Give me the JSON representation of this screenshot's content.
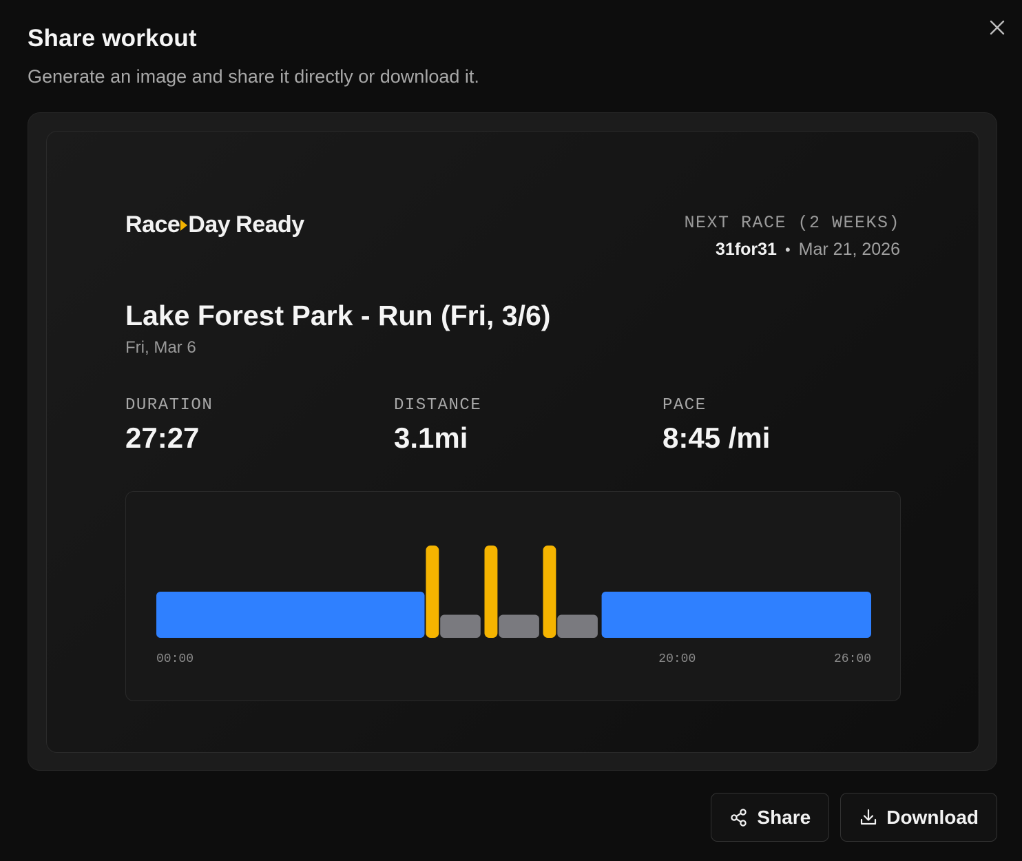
{
  "dialog": {
    "title": "Share workout",
    "subtitle": "Generate an image and share it directly or download it.",
    "close_icon": "close-icon"
  },
  "card": {
    "brand": {
      "part1": "Race",
      "part2": "Day",
      "part3": "Ready",
      "accent_color": "#f5b400"
    },
    "next_race": {
      "label": "NEXT RACE (2 WEEKS)",
      "name": "31for31",
      "separator": "•",
      "date": "Mar 21, 2026"
    },
    "workout": {
      "title": "Lake Forest Park - Run (Fri, 3/6)",
      "date": "Fri, Mar 6"
    },
    "stats": [
      {
        "label": "DURATION",
        "value": "27:27"
      },
      {
        "label": "DISTANCE",
        "value": "3.1mi"
      },
      {
        "label": "PACE",
        "value": "8:45 /mi"
      }
    ]
  },
  "chart_data": {
    "type": "bar",
    "x_unit": "minutes",
    "xlim": [
      0,
      27.45
    ],
    "tick_labels": [
      {
        "label": "00:00",
        "minute": 0
      },
      {
        "label": "20:00",
        "minute": 20
      },
      {
        "label": "26:00",
        "minute": 26
      }
    ],
    "segments": [
      {
        "start": 0.0,
        "end": 10.3,
        "intensity": 2,
        "kind": "easy"
      },
      {
        "start": 10.35,
        "end": 10.85,
        "intensity": 4,
        "kind": "interval"
      },
      {
        "start": 10.9,
        "end": 12.45,
        "intensity": 1,
        "kind": "recovery"
      },
      {
        "start": 12.6,
        "end": 13.1,
        "intensity": 4,
        "kind": "interval"
      },
      {
        "start": 13.15,
        "end": 14.7,
        "intensity": 1,
        "kind": "recovery"
      },
      {
        "start": 14.85,
        "end": 15.35,
        "intensity": 4,
        "kind": "interval"
      },
      {
        "start": 15.4,
        "end": 16.95,
        "intensity": 1,
        "kind": "recovery"
      },
      {
        "start": 17.1,
        "end": 27.45,
        "intensity": 2,
        "kind": "easy"
      }
    ],
    "colors": {
      "easy": "#2f80ff",
      "interval": "#f5b400",
      "recovery": "#7a7a7f"
    }
  },
  "actions": {
    "share": {
      "label": "Share",
      "icon": "share-icon"
    },
    "download": {
      "label": "Download",
      "icon": "download-icon"
    }
  }
}
